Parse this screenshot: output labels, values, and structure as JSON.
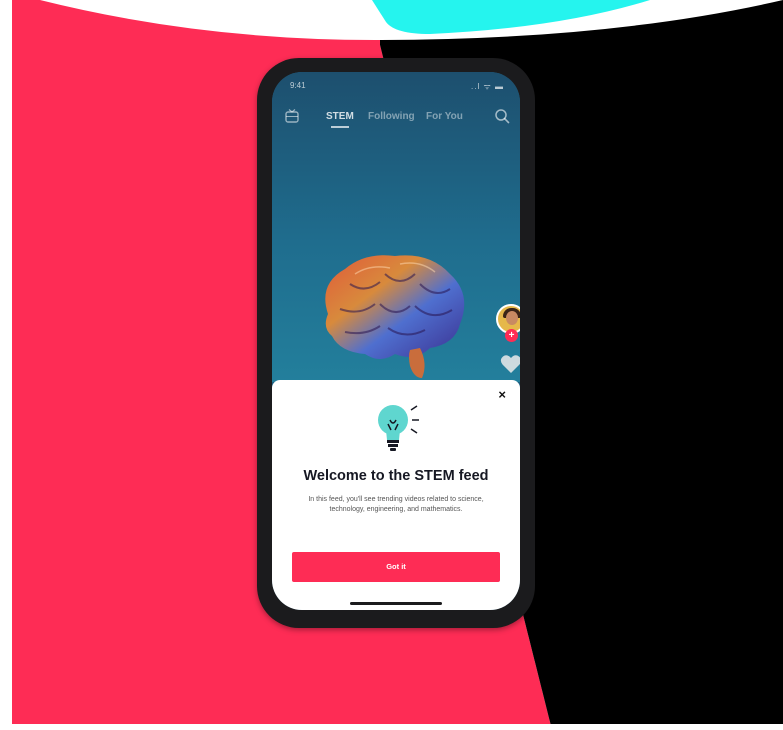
{
  "status_bar": {
    "time": "9:41",
    "indicators": "..l ᯤ ▬"
  },
  "topnav": {
    "tabs": [
      {
        "label": "STEM",
        "active": true
      },
      {
        "label": "Following",
        "active": false
      },
      {
        "label": "For You",
        "active": false
      }
    ],
    "left_icon": "tv-icon",
    "right_icon": "search-icon"
  },
  "video": {
    "subject_icon": "brain-icon",
    "background": "#1f6d8e"
  },
  "creator": {
    "avatar_icon": "avatar",
    "follow_glyph": "+"
  },
  "actions": {
    "like_icon": "heart-icon"
  },
  "modal": {
    "close_glyph": "×",
    "icon": "lightbulb-icon",
    "title": "Welcome to the STEM feed",
    "body": "In this feed, you'll see trending videos related to science, technology, engineering, and mathematics.",
    "button_label": "Got it"
  },
  "colors": {
    "brand_red": "#fe2c55",
    "brand_cyan": "#25f4ee",
    "black": "#000000",
    "bulb": "#5fd6cf"
  }
}
